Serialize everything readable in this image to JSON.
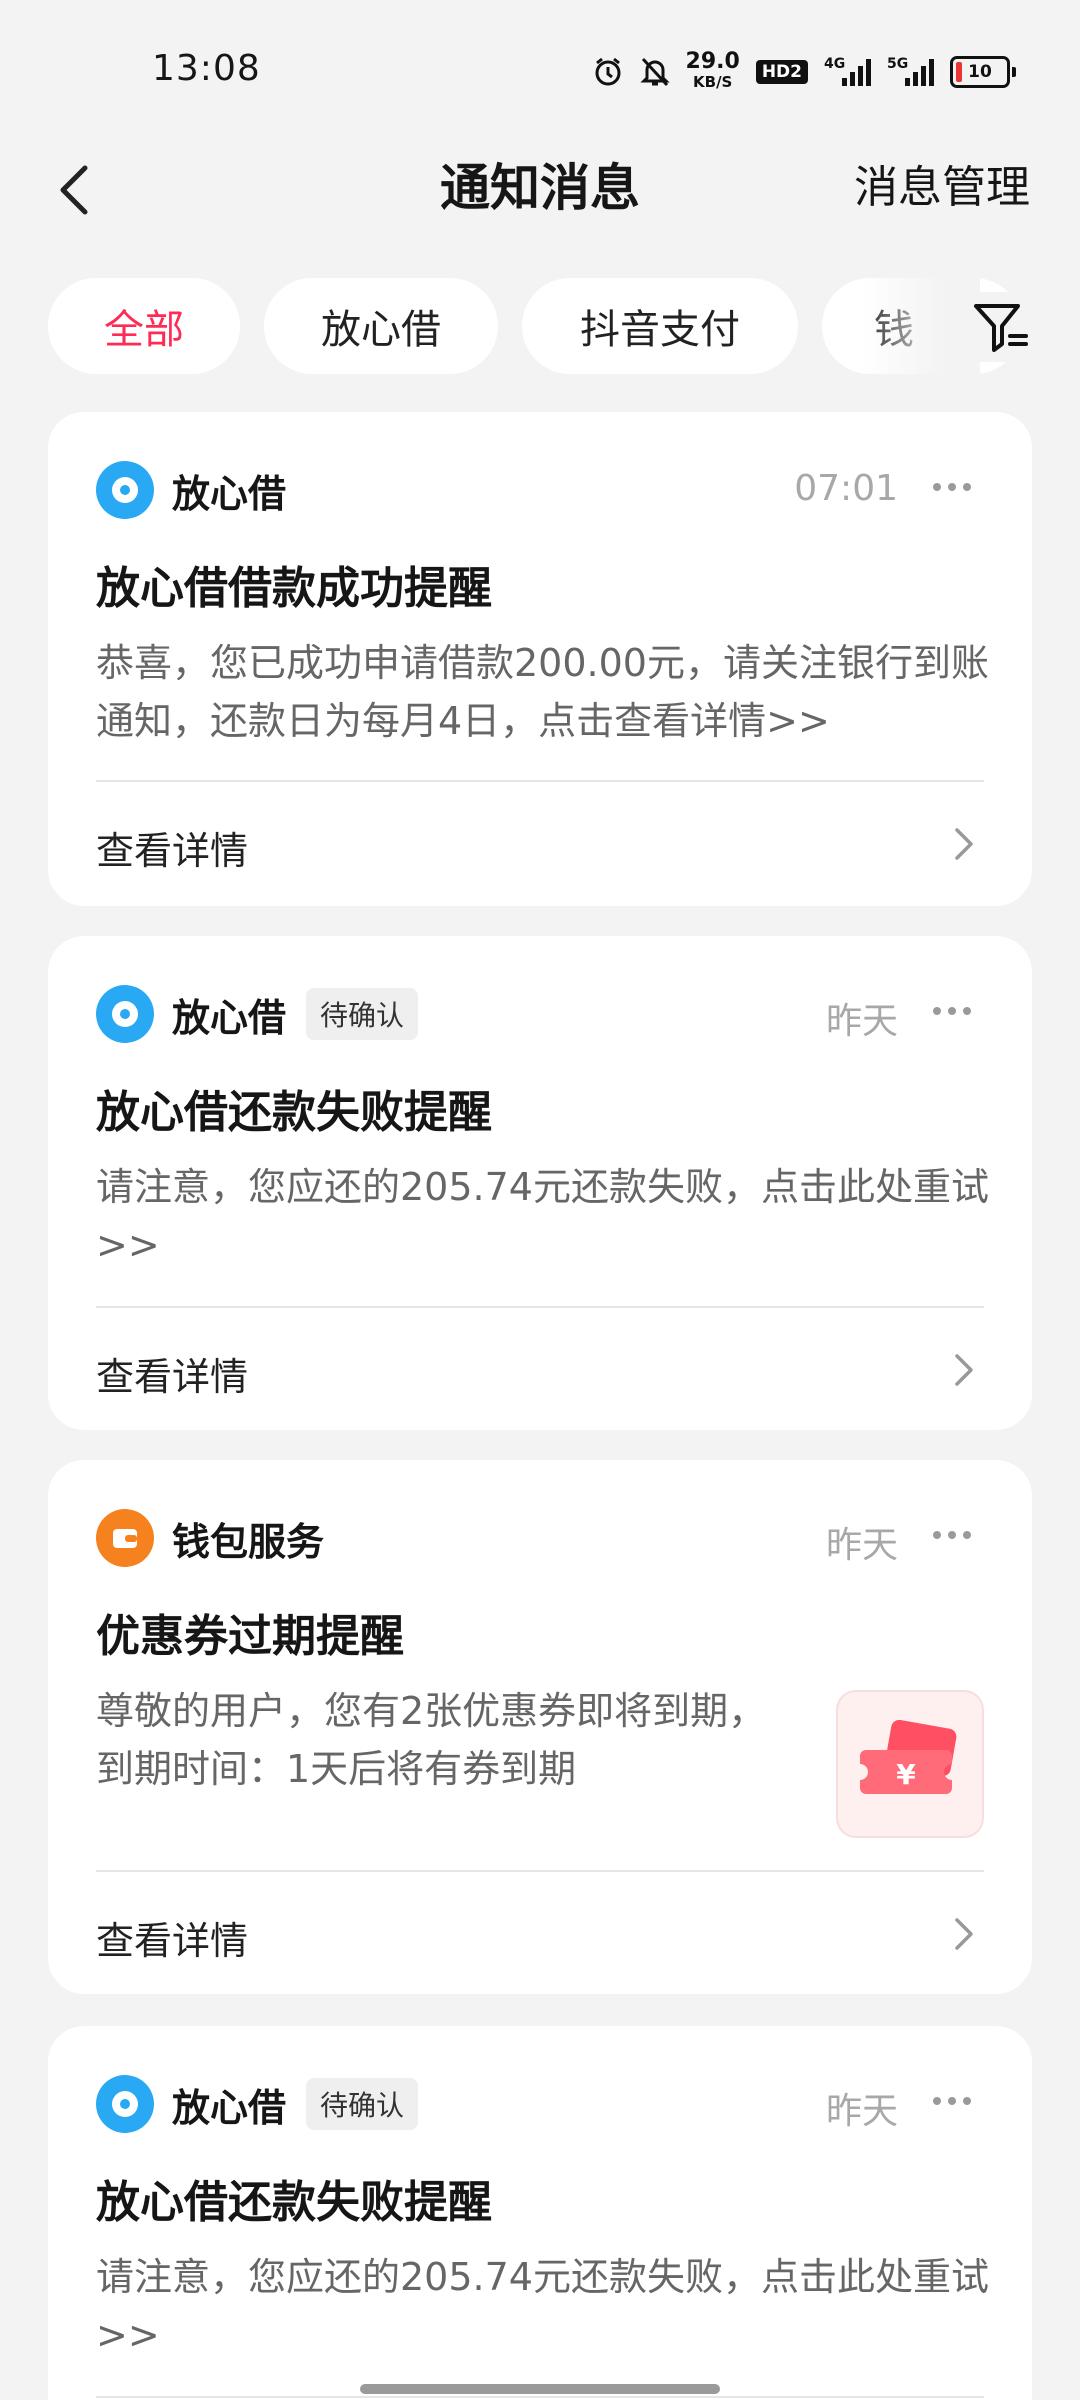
{
  "status_bar": {
    "time": "13:08",
    "net_speed": "29.0",
    "net_speed_unit": "KB/S",
    "hd_label": "HD2",
    "signal1_label": "4G",
    "signal2_label": "5G",
    "battery_level": "10",
    "icons": [
      "alarm-icon",
      "mute-bell-icon",
      "signal-4g-icon",
      "signal-5g-icon",
      "battery-icon"
    ]
  },
  "header": {
    "back_icon": "chevron-left-icon",
    "title": "通知消息",
    "manage_label": "消息管理"
  },
  "tabs": {
    "items": [
      "全部",
      "放心借",
      "抖音支付",
      "钱"
    ],
    "active_index": 0,
    "filter_icon": "filter-icon"
  },
  "colors": {
    "accent": "#fe2c55",
    "fxj_icon": "#29a9f3",
    "wallet_icon": "#f5821f",
    "background": "#f3f3f3"
  },
  "cards": [
    {
      "source": "放心借",
      "source_icon": "fxj-logo-icon",
      "badge": "",
      "time": "07:01",
      "title": "放心借借款成功提醒",
      "body": "恭喜，您已成功申请借款200.00元，请关注银行到账通知，还款日为每月4日，点击查看详情>>",
      "detail_label": "查看详情"
    },
    {
      "source": "放心借",
      "source_icon": "fxj-logo-icon",
      "badge": "待确认",
      "time": "昨天",
      "title": "放心借还款失败提醒",
      "body": "请注意，您应还的205.74元还款失败，点击此处重试>>",
      "detail_label": "查看详情"
    },
    {
      "source": "钱包服务",
      "source_icon": "wallet-icon",
      "badge": "",
      "time": "昨天",
      "title": "优惠券过期提醒",
      "body": "尊敬的用户，您有2张优惠券即将到期，到期时间：1天后将有券到期",
      "detail_label": "查看详情",
      "thumb_icon": "coupon-ticket-icon",
      "thumb_symbol": "¥"
    },
    {
      "source": "放心借",
      "source_icon": "fxj-logo-icon",
      "badge": "待确认",
      "time": "昨天",
      "title": "放心借还款失败提醒",
      "body": "请注意，您应还的205.74元还款失败，点击此处重试>>"
    }
  ]
}
